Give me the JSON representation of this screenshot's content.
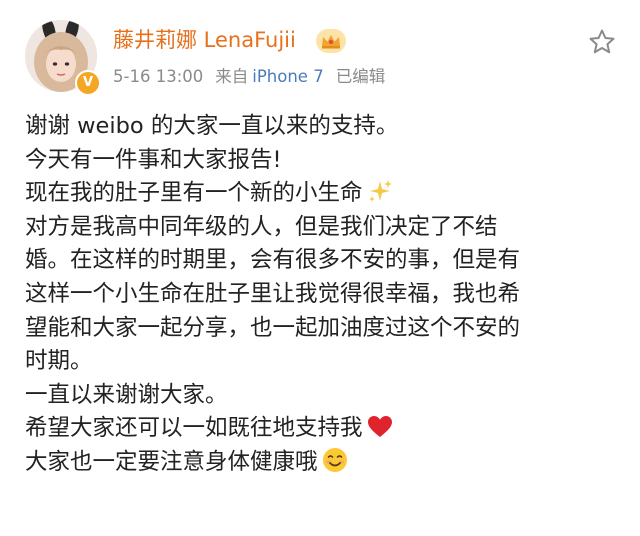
{
  "user": {
    "name": "藤井莉娜 LenaFujii",
    "timestamp": "5-16 13:00",
    "source_prefix": "来自",
    "device": "iPhone 7",
    "edited": "已编辑"
  },
  "post": {
    "lines": [
      "谢谢 weibo 的大家一直以来的支持。",
      "今天有一件事和大家报告!",
      "现在我的肚子里有一个新的小生命",
      "对方是我高中同年级的人，但是我们决定了不结",
      "婚。在这样的时期里，会有很多不安的事，但是有",
      "这样一个小生命在肚子里让我觉得很幸福，我也希",
      "望能和大家一起分享，也一起加油度过这个不安的",
      "时期。",
      "一直以来谢谢大家。",
      "希望大家还可以一如既往地支持我",
      "大家也一定要注意身体健康哦"
    ]
  },
  "icons": {
    "verified": "verified-badge-icon",
    "crown": "crown-icon",
    "star": "star-favorite-icon",
    "sparkles": "sparkles-emoji-icon",
    "heart": "red-heart-emoji-icon",
    "smile": "smiling-face-emoji-icon"
  },
  "colors": {
    "username": "#e8701a",
    "device": "#4a7bbd",
    "meta": "#8a8a8a",
    "text": "#222222"
  }
}
